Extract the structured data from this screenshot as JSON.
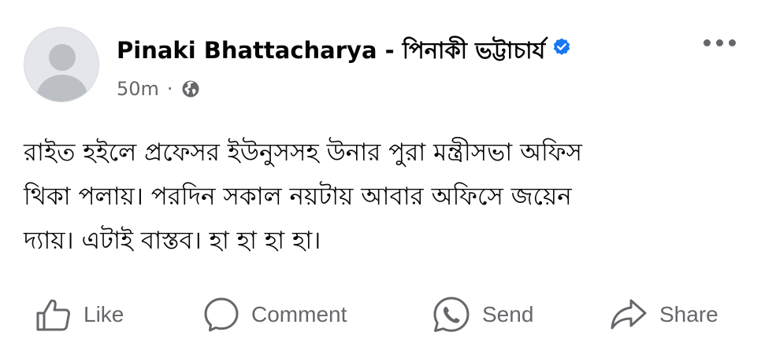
{
  "post": {
    "author": "Pinaki Bhattacharya - পিনাকী ভট্টাচার্য",
    "timestamp": "50m",
    "separator": "·",
    "audience_icon": "globe-icon",
    "verified_icon": "verified-badge-icon",
    "body_lines": [
      "রাইত হইলে প্রফেসর ইউনুসসহ উনার পুরা মন্ত্রীসভা অফিস",
      "থিকা পলায়। পরদিন সকাল নয়টায় আবার অফিসে জয়েন",
      "দ্যায়। এটাই বাস্তব। হা হা হা হা।"
    ]
  },
  "actions": {
    "like": "Like",
    "comment": "Comment",
    "send": "Send",
    "share": "Share"
  },
  "colors": {
    "text": "#050505",
    "secondary": "#65676b",
    "verified": "#1877f2",
    "avatar_bg": "#e4e6eb",
    "avatar_fg": "#bcc0c4"
  }
}
